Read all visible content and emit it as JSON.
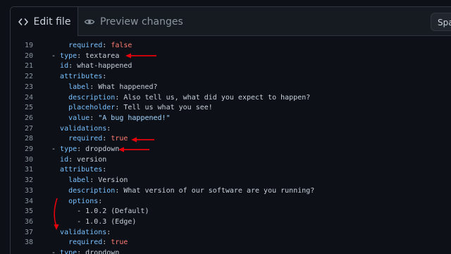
{
  "tabs": {
    "edit_label": "Edit file",
    "preview_label": "Preview changes"
  },
  "indent_select": {
    "value": "Spac"
  },
  "code_lines": [
    {
      "n": "19",
      "indent": "    ",
      "parts": [
        {
          "t": "required",
          "c": "kb"
        },
        {
          "t": ": ",
          "c": "p"
        },
        {
          "t": "false",
          "c": "b"
        }
      ]
    },
    {
      "n": "20",
      "indent": "",
      "parts": [
        {
          "t": "- ",
          "c": "p"
        },
        {
          "t": "type",
          "c": "kb"
        },
        {
          "t": ": textarea",
          "c": "p"
        }
      ]
    },
    {
      "n": "21",
      "indent": "  ",
      "parts": [
        {
          "t": "id",
          "c": "kb"
        },
        {
          "t": ": what-happened",
          "c": "p"
        }
      ]
    },
    {
      "n": "22",
      "indent": "  ",
      "parts": [
        {
          "t": "attributes",
          "c": "kb"
        },
        {
          "t": ":",
          "c": "p"
        }
      ]
    },
    {
      "n": "23",
      "indent": "    ",
      "parts": [
        {
          "t": "label",
          "c": "kb"
        },
        {
          "t": ": What happened?",
          "c": "p"
        }
      ]
    },
    {
      "n": "24",
      "indent": "    ",
      "parts": [
        {
          "t": "description",
          "c": "kb"
        },
        {
          "t": ": Also tell us, what did you expect to happen?",
          "c": "p"
        }
      ]
    },
    {
      "n": "25",
      "indent": "    ",
      "parts": [
        {
          "t": "placeholder",
          "c": "kb"
        },
        {
          "t": ": Tell us what you see!",
          "c": "p"
        }
      ]
    },
    {
      "n": "26",
      "indent": "    ",
      "parts": [
        {
          "t": "value",
          "c": "kb"
        },
        {
          "t": ": ",
          "c": "p"
        },
        {
          "t": "\"A bug happened!\"",
          "c": "s"
        }
      ]
    },
    {
      "n": "27",
      "indent": "  ",
      "parts": [
        {
          "t": "validations",
          "c": "kb"
        },
        {
          "t": ":",
          "c": "p"
        }
      ]
    },
    {
      "n": "28",
      "indent": "    ",
      "parts": [
        {
          "t": "required",
          "c": "kb"
        },
        {
          "t": ": ",
          "c": "p"
        },
        {
          "t": "true",
          "c": "b"
        }
      ]
    },
    {
      "n": "29",
      "indent": "",
      "parts": [
        {
          "t": "- ",
          "c": "p"
        },
        {
          "t": "type",
          "c": "kb"
        },
        {
          "t": ": dropdown",
          "c": "p"
        }
      ]
    },
    {
      "n": "30",
      "indent": "  ",
      "parts": [
        {
          "t": "id",
          "c": "kb"
        },
        {
          "t": ": version",
          "c": "p"
        }
      ]
    },
    {
      "n": "31",
      "indent": "  ",
      "parts": [
        {
          "t": "attributes",
          "c": "kb"
        },
        {
          "t": ":",
          "c": "p"
        }
      ]
    },
    {
      "n": "32",
      "indent": "    ",
      "parts": [
        {
          "t": "label",
          "c": "kb"
        },
        {
          "t": ": Version",
          "c": "p"
        }
      ]
    },
    {
      "n": "33",
      "indent": "    ",
      "parts": [
        {
          "t": "description",
          "c": "kb"
        },
        {
          "t": ": What version of our software are you running?",
          "c": "p"
        }
      ]
    },
    {
      "n": "34",
      "indent": "    ",
      "parts": [
        {
          "t": "options",
          "c": "kb"
        },
        {
          "t": ":",
          "c": "p"
        }
      ]
    },
    {
      "n": "35",
      "indent": "      ",
      "parts": [
        {
          "t": "- 1.0.2 (Default)",
          "c": "p"
        }
      ]
    },
    {
      "n": "36",
      "indent": "      ",
      "parts": [
        {
          "t": "- 1.0.3 (Edge)",
          "c": "p"
        }
      ]
    },
    {
      "n": "37",
      "indent": "  ",
      "parts": [
        {
          "t": "validations",
          "c": "kb"
        },
        {
          "t": ":",
          "c": "p"
        }
      ]
    },
    {
      "n": "38",
      "indent": "    ",
      "parts": [
        {
          "t": "required",
          "c": "kb"
        },
        {
          "t": ": ",
          "c": "p"
        },
        {
          "t": "true",
          "c": "b"
        }
      ]
    },
    {
      "n": "",
      "indent": "",
      "parts": [
        {
          "t": "- ",
          "c": "p"
        },
        {
          "t": "type",
          "c": "kb"
        },
        {
          "t": ": dropdown",
          "c": "p"
        }
      ]
    }
  ],
  "colors": {
    "background": "#0d1117",
    "key": "#79c0ff",
    "boolean": "#ff7b72",
    "string": "#a5d6ff",
    "plain": "#c9d1d9",
    "line_number": "#8b949e",
    "annotation": "#e5000b"
  }
}
